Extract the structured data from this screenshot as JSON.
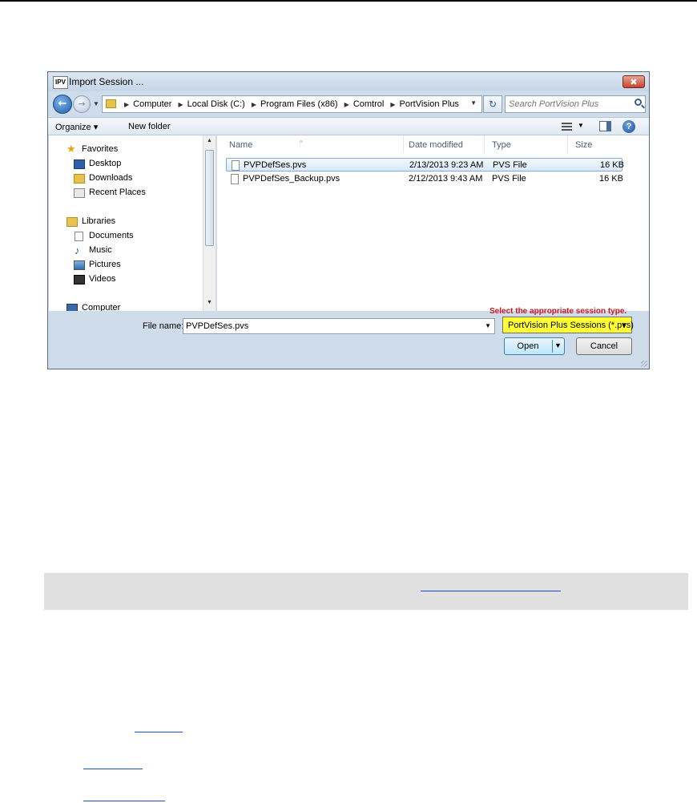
{
  "dialog": {
    "app_icon": "IPV",
    "title": "Import Session ...",
    "close_label": "✖",
    "breadcrumbs": [
      "Computer",
      "Local Disk (C:)",
      "Program Files (x86)",
      "Comtrol",
      "PortVision Plus"
    ],
    "search_placeholder": "Search PortVision Plus",
    "toolbar": {
      "organize": "Organize ▾",
      "new_folder": "New folder"
    },
    "nav": [
      {
        "label": "Favorites",
        "icon": "star-icon"
      },
      {
        "label": "Desktop",
        "icon": "desktop-icon"
      },
      {
        "label": "Downloads",
        "icon": "downloads-icon"
      },
      {
        "label": "Recent Places",
        "icon": "recent-places-icon"
      },
      {
        "label": "Libraries",
        "icon": "libraries-icon"
      },
      {
        "label": "Documents",
        "icon": "documents-icon"
      },
      {
        "label": "Music",
        "icon": "music-icon"
      },
      {
        "label": "Pictures",
        "icon": "pictures-icon"
      },
      {
        "label": "Videos",
        "icon": "videos-icon"
      },
      {
        "label": "Computer",
        "icon": "computer-icon"
      }
    ],
    "columns": [
      "Name",
      "Date modified",
      "Type",
      "Size"
    ],
    "files": [
      {
        "name": "PVPDefSes.pvs",
        "date": "2/13/2013 9:23 AM",
        "type": "PVS File",
        "size": "16 KB",
        "selected": true
      },
      {
        "name": "PVPDefSes_Backup.pvs",
        "date": "2/12/2013 9:43 AM",
        "type": "PVS File",
        "size": "16 KB",
        "selected": false
      }
    ],
    "annotation": "Select the appropriate session type.",
    "file_name_label": "File name:",
    "file_name_value": "PVPDefSes.pvs",
    "file_type": "PortVision Plus Sessions (*.pvs)",
    "open_label": "Open",
    "cancel_label": "Cancel",
    "highlight_color": "#ffff33",
    "annotation_color": "#d0121b"
  }
}
